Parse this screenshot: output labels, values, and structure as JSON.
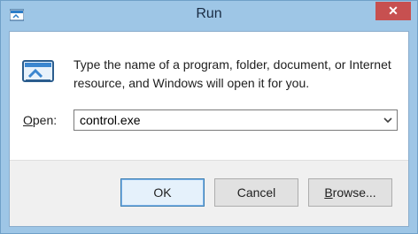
{
  "window": {
    "title": "Run",
    "close_label": "✕"
  },
  "dialog": {
    "message": "Type the name of a program, folder, document, or Internet resource, and Windows will open it for you.",
    "open_label_accel": "O",
    "open_label_rest": "pen:",
    "command_value": "control.exe"
  },
  "buttons": {
    "ok": "OK",
    "cancel": "Cancel",
    "browse_accel": "B",
    "browse_rest": "rowse..."
  },
  "icons": {
    "app": "run-app-icon",
    "run": "run-dialog-icon",
    "dropdown": "chevron-down-icon",
    "close": "close-icon"
  },
  "colors": {
    "frame": "#9ec6e6",
    "close_button": "#c75050",
    "ok_border": "#3c7fb1"
  }
}
